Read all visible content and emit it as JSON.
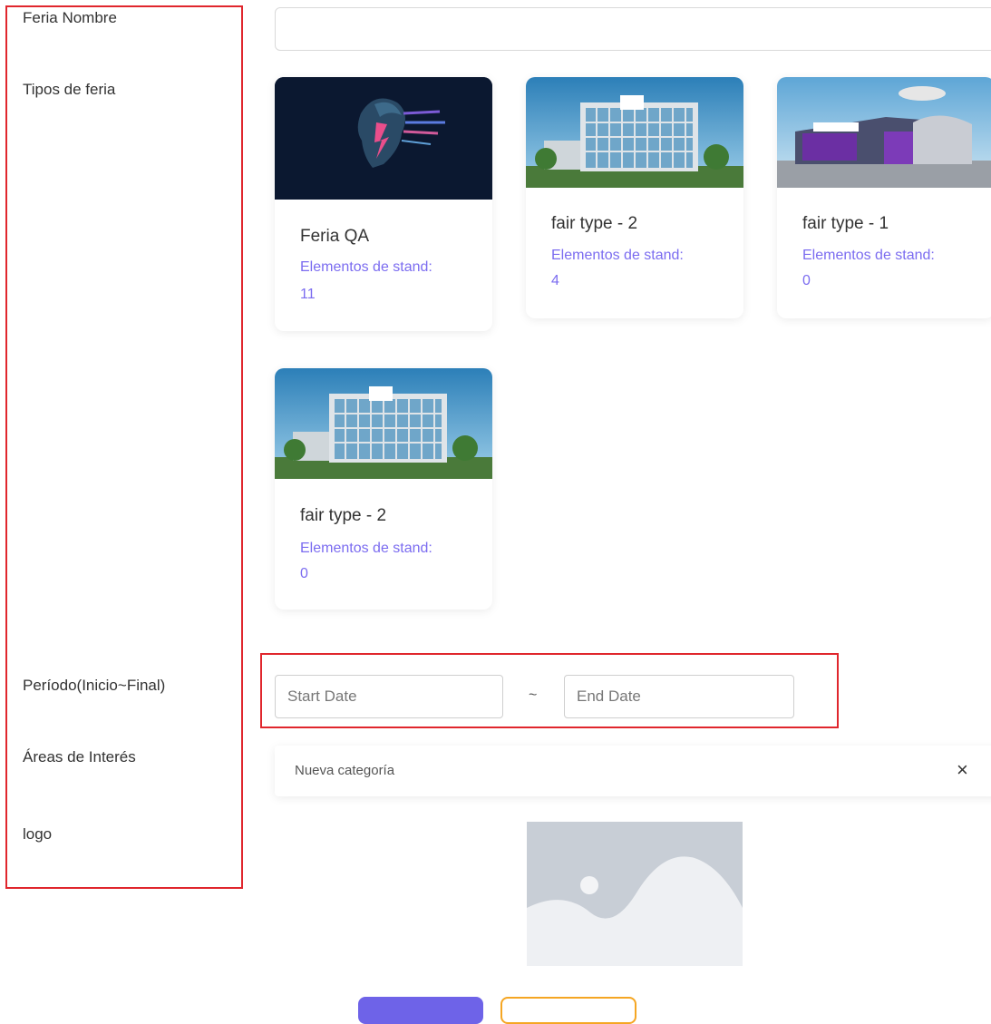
{
  "form": {
    "labels": {
      "name": "Feria Nombre",
      "types": "Tipos de feria",
      "period": "Período(Inicio~Final)",
      "areas": "Áreas de Interés",
      "logo": "logo"
    },
    "name_value": ""
  },
  "fair_types": [
    {
      "title": "Feria QA",
      "elements_label": "Elementos de stand:",
      "elements_count": "11"
    },
    {
      "title": "fair type - 2",
      "elements_label": "Elementos de stand:",
      "elements_count": "4"
    },
    {
      "title": "fair type - 1",
      "elements_label": "Elementos de stand:",
      "elements_count": "0"
    },
    {
      "title": "fair type - 2",
      "elements_label": "Elementos de stand:",
      "elements_count": "0"
    }
  ],
  "period": {
    "start_placeholder": "Start Date",
    "separator": "~",
    "end_placeholder": "End Date"
  },
  "areas": {
    "category_label": "Nueva categoría",
    "close_icon": "×"
  },
  "colors": {
    "accent": "#6e63e8",
    "link_purple": "#7b6cf0",
    "annotation_red": "#e0262d",
    "warning": "#f5a623"
  }
}
